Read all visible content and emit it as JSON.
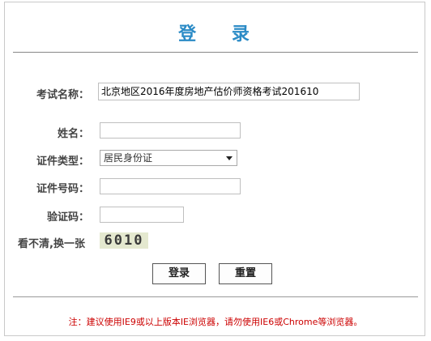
{
  "header": {
    "title": "登 录"
  },
  "form": {
    "exam_label": "考试名称：",
    "exam_value": "北京地区2016年度房地产估价师资格考试201610",
    "name_label": "姓名：",
    "name_value": "",
    "id_type_label": "证件类型：",
    "id_type_selected": "居民身份证",
    "id_number_label": "证件号码：",
    "id_number_value": "",
    "captcha_label": "验证码：",
    "captcha_value": "",
    "refresh_label": "看不清,换一张",
    "captcha_text": "6010"
  },
  "buttons": {
    "login": "登录",
    "reset": "重置"
  },
  "notice": "注：建议使用IE9或以上版本IE浏览器，请勿使用IE6或Chrome等浏览器。",
  "colors": {
    "title": "#2b8bc6",
    "notice": "#cc0000"
  }
}
